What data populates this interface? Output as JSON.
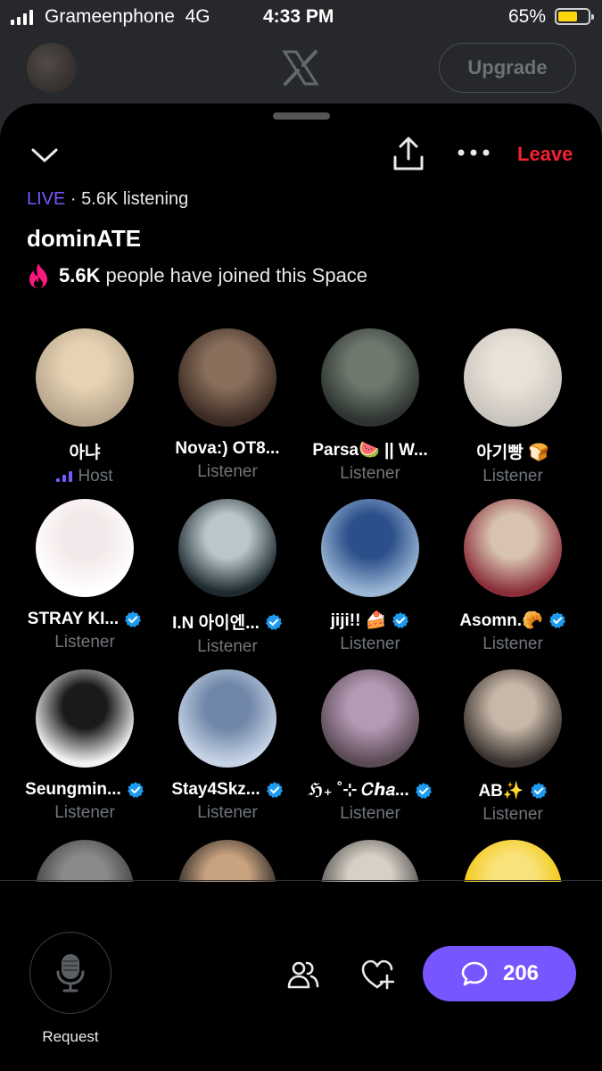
{
  "status_bar": {
    "carrier": "Grameenphone",
    "network": "4G",
    "time": "4:33 PM",
    "battery_percent": "65%",
    "battery_level": 0.65
  },
  "background_header": {
    "upgrade_label": "Upgrade"
  },
  "space": {
    "leave_label": "Leave",
    "live_label": "LIVE",
    "listening_text": "· 5.6K listening",
    "title": "dominATE",
    "joined_count": "5.6K",
    "joined_text": "people have joined this Space"
  },
  "participants": [
    {
      "name": "아냐",
      "role": "Host",
      "verified": false,
      "colors": [
        "#b7a58d",
        "#e6d3b3"
      ]
    },
    {
      "name": "Nova:) OT8...",
      "role": "Listener",
      "verified": false,
      "colors": [
        "#3a2a22",
        "#8a6f5c"
      ]
    },
    {
      "name": "Parsa🍉 || W...",
      "role": "Listener",
      "verified": false,
      "colors": [
        "#2d3330",
        "#6f7a6f"
      ]
    },
    {
      "name": "아기빵 🍞",
      "role": "Listener",
      "verified": false,
      "colors": [
        "#c9c4bd",
        "#e9e2d8"
      ]
    },
    {
      "name": "STRAY KI...",
      "role": "Listener",
      "verified": true,
      "colors": [
        "#ffffff",
        "#f4e9ea"
      ]
    },
    {
      "name": "I.N 아이엔...",
      "role": "Listener",
      "verified": true,
      "colors": [
        "#1e2a30",
        "#b9c7cd"
      ]
    },
    {
      "name": "jiji!! 🍰",
      "role": "Listener",
      "verified": true,
      "colors": [
        "#9bb7d6",
        "#2b4f8a"
      ]
    },
    {
      "name": "Asomn.🥐",
      "role": "Listener",
      "verified": true,
      "colors": [
        "#8a2f3a",
        "#d8c2b0"
      ]
    },
    {
      "name": "Seungmin...",
      "role": "Listener",
      "verified": true,
      "colors": [
        "#f2f2f2",
        "#1a1a1a"
      ]
    },
    {
      "name": "Stay4Skz...",
      "role": "Listener",
      "verified": true,
      "colors": [
        "#c7d4e6",
        "#6f86a8"
      ]
    },
    {
      "name": "ℌ₊ ˚⊹ 𝐶ℎ𝑎...",
      "role": "Listener",
      "verified": true,
      "colors": [
        "#5a4a55",
        "#b59ab5"
      ]
    },
    {
      "name": "AB✨",
      "role": "Listener",
      "verified": true,
      "colors": [
        "#3a3330",
        "#c8b8a8"
      ]
    },
    {
      "name": "",
      "role": "",
      "verified": false,
      "colors": [
        "#3a3a3a",
        "#8a8a8a"
      ]
    },
    {
      "name": "",
      "role": "",
      "verified": false,
      "colors": [
        "#1e1e1e",
        "#c9a27f"
      ]
    },
    {
      "name": "",
      "role": "",
      "verified": false,
      "colors": [
        "#4a4a4a",
        "#d8cfc5"
      ]
    },
    {
      "name": "",
      "role": "",
      "verified": false,
      "colors": [
        "#f2c300",
        "#f9e27a"
      ]
    }
  ],
  "bottom_bar": {
    "request_label": "Request",
    "comments_count": "206"
  },
  "colors": {
    "accent": "#7856ff",
    "leave": "#f4212e",
    "verified": "#1d9bf0",
    "flame": "#f91880"
  },
  "icons": [
    "chevron-down-icon",
    "share-icon",
    "more-icon",
    "flame-icon",
    "verified-icon",
    "host-speaking-icon",
    "microphone-icon",
    "people-icon",
    "heart-plus-icon",
    "comment-icon",
    "x-logo-icon"
  ]
}
